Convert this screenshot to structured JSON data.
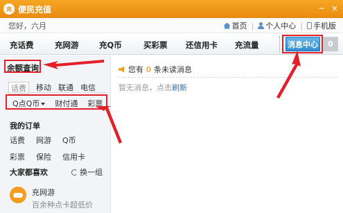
{
  "window": {
    "title": "便民充值",
    "logo_text": "充",
    "minimize": "−",
    "close": "×"
  },
  "greeting": "您好，六月",
  "top_links": {
    "home": "首页",
    "personal": "个人中心",
    "mobile": "手机版",
    "separator": "|"
  },
  "nav": {
    "items": [
      "充话费",
      "充网游",
      "充Q币",
      "买彩票",
      "还信用卡",
      "充流量"
    ],
    "message_center": "消息中心",
    "message_count": "0"
  },
  "sidebar": {
    "balance_title": "余额查询",
    "tabs": [
      "话费",
      "移动",
      "联通",
      "电信"
    ],
    "pay_options": [
      "Q点Q币",
      "财付通",
      "彩票"
    ],
    "orders_title": "我的订单",
    "orders": [
      "话费",
      "网游",
      "Q币",
      "彩票",
      "保险",
      "信用卡"
    ],
    "likes_title": "大家都喜欢",
    "refresh_label": "换一组",
    "promo": {
      "name": "充网游",
      "desc": "百余种点卡超低价"
    }
  },
  "main": {
    "unread_prefix": "您有",
    "unread_count": "0",
    "unread_suffix": "条未读消息",
    "empty_text": "暂无消息，点击",
    "refresh_link": "刷新"
  },
  "colors": {
    "titlebar": "#e98a10",
    "accent_blue": "#2f8ed4",
    "annotation_red": "#e3202a"
  }
}
